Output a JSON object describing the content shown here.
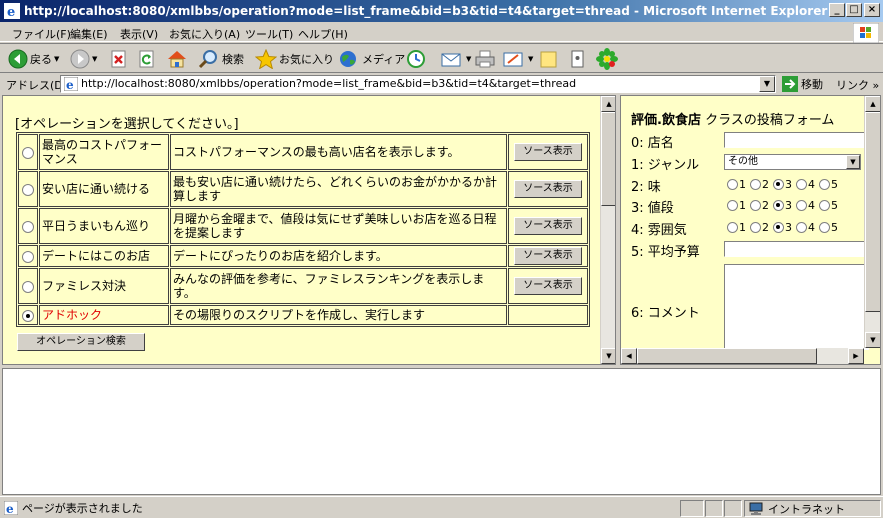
{
  "window": {
    "title": "http://localhost:8080/xmlbbs/operation?mode=list_frame&bid=b3&tid=t4&target=thread - Microsoft Internet Explorer",
    "min_label": "_",
    "max_label": "□",
    "close_label": "×"
  },
  "menu": [
    "ファイル(F)",
    "編集(E)",
    "表示(V)",
    "お気に入り(A)",
    "ツール(T)",
    "ヘルプ(H)"
  ],
  "toolbar": {
    "back_label": "戻る",
    "search_label": "検索",
    "favorites_label": "お気に入り",
    "media_label": "メディア"
  },
  "address": {
    "label": "アドレス(D)",
    "url": "http://localhost:8080/xmlbbs/operation?mode=list_frame&bid=b3&tid=t4&target=thread",
    "go_label": "移動",
    "links_label": "リンク »"
  },
  "operations": {
    "heading": "[オペレーションを選択してください。]",
    "source_button_label": "ソース表示",
    "search_button_label": "オペレーション検索",
    "items": [
      {
        "name": "最高のコストパフォーマンス",
        "description": "コストパフォーマンスの最も高い店名を表示します。",
        "selected": false,
        "has_source": true
      },
      {
        "name": "安い店に通い続ける",
        "description": "最も安い店に通い続けたら、どれくらいのお金がかかるか計算します",
        "selected": false,
        "has_source": true
      },
      {
        "name": "平日うまいもん巡り",
        "description": "月曜から金曜まで、値段は気にせず美味しいお店を巡る日程を提案します",
        "selected": false,
        "has_source": true
      },
      {
        "name": "デートにはこのお店",
        "description": "デートにぴったりのお店を紹介します。",
        "selected": false,
        "has_source": true
      },
      {
        "name": "ファミレス対決",
        "description": "みんなの評価を参考に、ファミレスランキングを表示します。",
        "selected": false,
        "has_source": true
      },
      {
        "name": "アドホック",
        "description": "その場限りのスクリプトを作成し、実行します",
        "selected": true,
        "has_source": false
      }
    ]
  },
  "post_form": {
    "title_bold": "評価.飲食店",
    "title_rest": " クラスの投稿フォーム",
    "fields": {
      "shop_name": {
        "label": "0:  店名",
        "value": ""
      },
      "genre": {
        "label": "1:  ジャンル",
        "value": "その他"
      },
      "taste": {
        "label": "2:  味",
        "options": [
          "1",
          "2",
          "3",
          "4",
          "5"
        ],
        "selected": "3"
      },
      "price": {
        "label": "3:  値段",
        "options": [
          "1",
          "2",
          "3",
          "4",
          "5"
        ],
        "selected": "3"
      },
      "atmosphere": {
        "label": "4:  雰囲気",
        "options": [
          "1",
          "2",
          "3",
          "4",
          "5"
        ],
        "selected": "3"
      },
      "budget": {
        "label": "5:  平均予算",
        "value": ""
      },
      "comment": {
        "label": "6:  コメント",
        "value": ""
      }
    }
  },
  "status": {
    "text": "ページが表示されました",
    "zone": "イントラネット"
  }
}
